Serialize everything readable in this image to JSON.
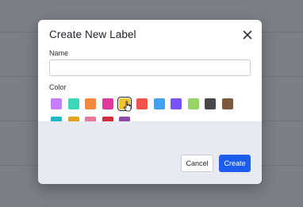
{
  "dialog": {
    "title": "Create New Label",
    "close_icon": "close-icon"
  },
  "form": {
    "name_label": "Name",
    "name_value": "",
    "name_placeholder": "",
    "color_label": "Color"
  },
  "colors": {
    "row1": [
      "#c77dff",
      "#3dd7b8",
      "#f5883a",
      "#e0399c",
      "#f2c230",
      "#f2524a",
      "#40a1f2",
      "#7a52f5",
      "#96d467",
      "#484848",
      "#7b5a3e"
    ],
    "row2": [
      "#22b7c7",
      "#e3a31e",
      "#e8799a",
      "#d32c3c",
      "#8c48a8"
    ],
    "selected": "#f2c230",
    "cursor_icon": "hand-pointer-icon"
  },
  "footer": {
    "cancel_label": "Cancel",
    "create_label": "Create"
  }
}
